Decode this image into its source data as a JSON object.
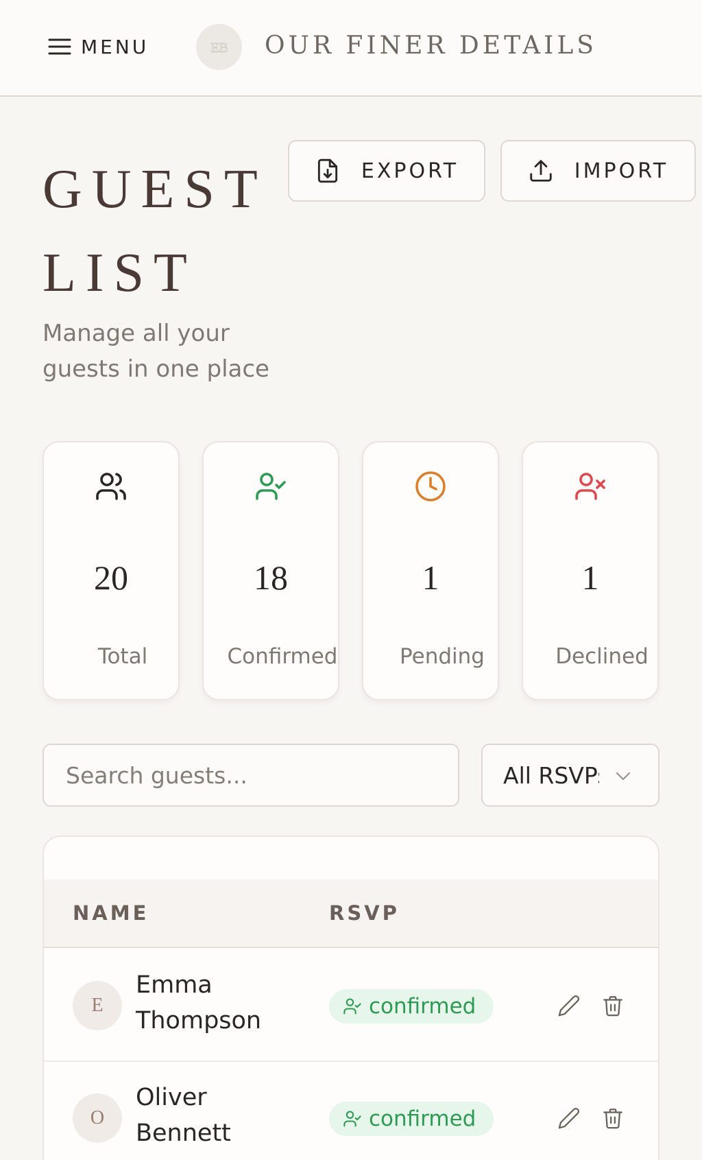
{
  "header": {
    "menu_label": "MENU",
    "logo_monogram": "EB",
    "brand": "OUR FINER DETAILS"
  },
  "page": {
    "title": "GUEST LIST",
    "subtitle": "Manage all your guests in one place"
  },
  "actions": {
    "export_label": "EXPORT",
    "import_label": "IMPORT"
  },
  "stats": [
    {
      "key": "total",
      "value": "20",
      "label": "Total",
      "icon": "users-icon",
      "color": "#2b2623"
    },
    {
      "key": "confirmed",
      "value": "18",
      "label": "Confirmed",
      "icon": "user-check-icon",
      "color": "#2f9a55"
    },
    {
      "key": "pending",
      "value": "1",
      "label": "Pending",
      "icon": "clock-icon",
      "color": "#d9802f"
    },
    {
      "key": "declined",
      "value": "1",
      "label": "Declined",
      "icon": "user-x-icon",
      "color": "#e0474f"
    }
  ],
  "search": {
    "placeholder": "Search guests...",
    "value": ""
  },
  "filter": {
    "selected": "All RSVPs"
  },
  "table": {
    "columns": [
      "NAME",
      "RSVP"
    ],
    "rows": [
      {
        "initial": "E",
        "name": "Emma Thompson",
        "rsvp": "confirmed"
      },
      {
        "initial": "O",
        "name": "Oliver Bennett",
        "rsvp": "confirmed"
      }
    ]
  },
  "colors": {
    "background": "#f8f6f3",
    "title": "#4a3a36",
    "confirmed_badge_bg": "#e6f6ea",
    "confirmed_text": "#2f9a55"
  }
}
